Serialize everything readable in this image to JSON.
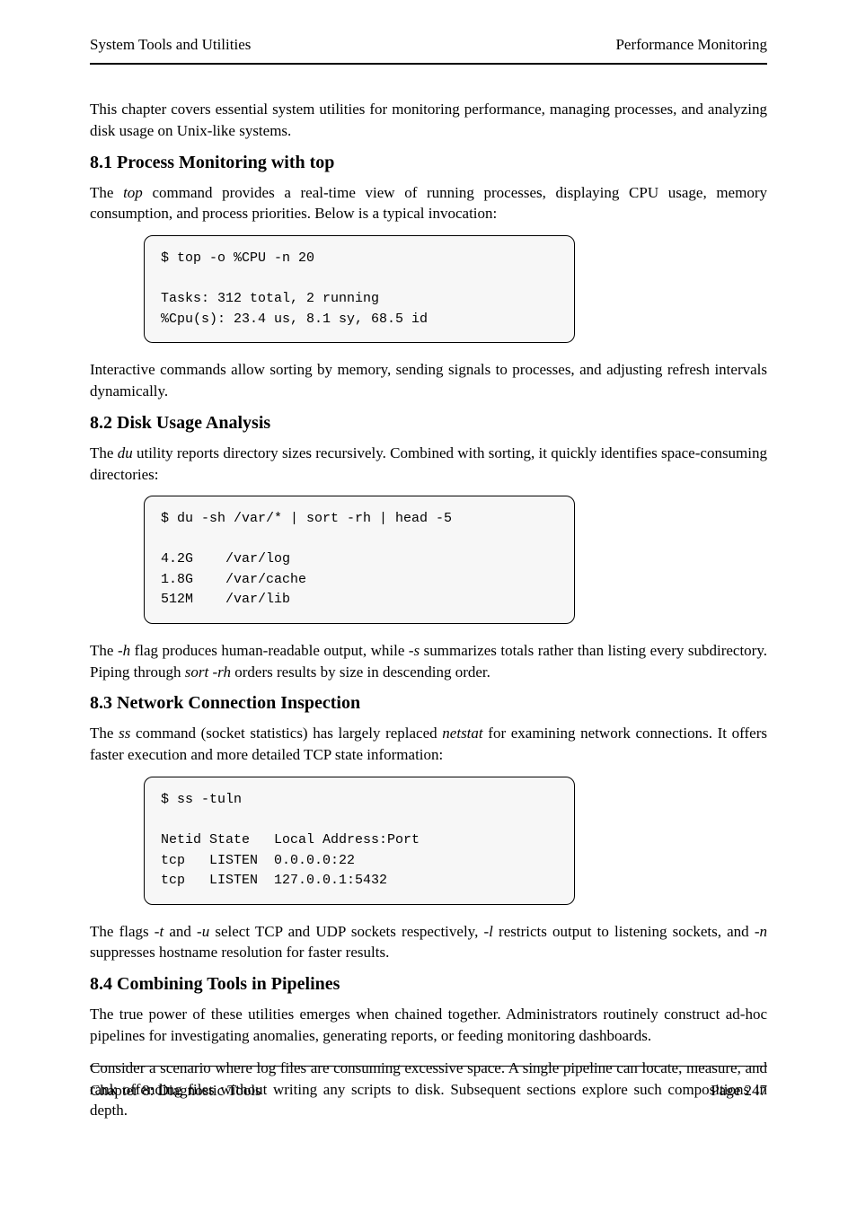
{
  "header": {
    "left": "System Tools and Utilities",
    "right": "Performance Monitoring"
  },
  "footer": {
    "left": "Chapter 8: Diagnostic Tools",
    "right": "Page 247"
  },
  "body": {
    "intro": "This chapter covers essential system utilities for monitoring performance, managing processes, and analyzing disk usage on Unix-like systems.",
    "s1": {
      "title": "8.1 Process Monitoring with top",
      "p1_a": "The ",
      "p1_cmd": "top",
      "p1_b": " command provides a real-time view of running processes, displaying CPU usage, memory consumption, and process priorities. Below is a typical invocation:",
      "code": "$ top -o %CPU -n 20\n\nTasks: 312 total, 2 running\n%Cpu(s): 23.4 us, 8.1 sy, 68.5 id",
      "p2": "Interactive commands allow sorting by memory, sending signals to processes, and adjusting refresh intervals dynamically."
    },
    "s2": {
      "title": "8.2 Disk Usage Analysis",
      "p1_a": "The ",
      "p1_cmd": "du",
      "p1_b": " utility reports directory sizes recursively. Combined with sorting, it quickly identifies space-consuming directories:",
      "code": "$ du -sh /var/* | sort -rh | head -5\n\n4.2G    /var/log\n1.8G    /var/cache\n512M    /var/lib",
      "p2_a": "The ",
      "p2_flag": "-h",
      "p2_b": " flag produces human-readable output, while ",
      "p2_flag2": "-s",
      "p2_c": " summarizes totals rather than listing every subdirectory. Piping through ",
      "p2_cmd": "sort -rh",
      "p2_d": " orders results by size in descending order."
    },
    "s3": {
      "title": "8.3 Network Connection Inspection",
      "p1_a": "The ",
      "p1_cmd": "ss",
      "p1_b": " command (socket statistics) has largely replaced ",
      "p1_cmd2": "netstat",
      "p1_c": " for examining network connections. It offers faster execution and more detailed TCP state information:",
      "code": "$ ss -tuln\n\nNetid State   Local Address:Port\ntcp   LISTEN  0.0.0.0:22\ntcp   LISTEN  127.0.0.1:5432",
      "p2_a": "The flags ",
      "p2_flag": "-t",
      "p2_b": " and ",
      "p2_flag2": "-u",
      "p2_c": " select TCP and UDP sockets respectively, ",
      "p2_flag3": "-l",
      "p2_d": " restricts output to listening sockets, and ",
      "p2_flag4": "-n",
      "p2_e": " suppresses hostname resolution for faster results."
    },
    "s4": {
      "title": "8.4 Combining Tools in Pipelines",
      "p1": "The true power of these utilities emerges when chained together. Administrators routinely construct ad-hoc pipelines for investigating anomalies, generating reports, or feeding monitoring dashboards.",
      "p2": "Consider a scenario where log files are consuming excessive space. A single pipeline can locate, measure, and rank offending files without writing any scripts to disk. Subsequent sections explore such compositions in depth."
    }
  }
}
